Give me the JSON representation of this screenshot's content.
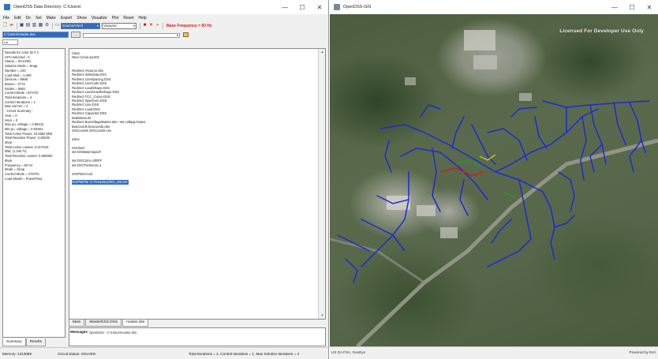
{
  "left_window": {
    "title": "OpenDSS Data Directory: C:\\Users\\",
    "controls": {
      "minimize": "—",
      "maximize": "☐",
      "close": "✕"
    },
    "menu": [
      "File",
      "Edit",
      "Do",
      "Set",
      "Make",
      "Export",
      "Show",
      "Visualize",
      "Plot",
      "Reset",
      "Help"
    ],
    "toolbar": {
      "combo_source": "Source/Vsrcl",
      "combo_class": "Vsource",
      "frequency_label": "Base Frequency = 60 Hz"
    },
    "path_field": "C:\\Users\\master.dss",
    "path_button": "...",
    "summary_lines": [
      "Results for Actor ID # 1",
      "CPU selected : 0",
      "Status = SOLVED",
      "Solution Mode = Snap",
      "Number = 100",
      "Load Mult = 1.000",
      "Devices = 6858",
      "Buses = 3774",
      "Nodes = 9661",
      "Control Mode =STATIC",
      "Total Iterations = 4",
      "Control Iterations = 1",
      "Max Sol Iter = 4",
      "",
      " - Circuit Summary -",
      "",
      "Year = 0",
      "Hour = 0",
      "Max pu. voltage = 0.96212",
      "Min pu. voltage = 0.93461",
      "Total Active Power:   23.6062 MW",
      "Total Reactive Power: 3.38238",
      "Mvar",
      "Total Active Losses:   0.317319",
      "MW, (1.344 %)",
      "Total Reactive Losses: 0.668352",
      "Mvar",
      "Frequency = 60 Hz",
      "Mode = Snap",
      "Control Mode = STATIC",
      "Load Model = PowerFlow"
    ],
    "left_tabs": [
      "Summary",
      "Results"
    ],
    "script_lines": [
      "Clear",
      "New Circuit.ipc201",
      "",
      "",
      "Redirect Vsource.dss",
      "Redirect WireData.DSS",
      "Redirect LineSpacing.DSS",
      "Redirect LineCode.DSS",
      "Redirect LoadShape.DSS",
      "Redirect LineGrowthShape.DSS",
      "Redirect TCC_Curve.DSS",
      "Redirect Spectrum.DSS",
      "Redirect Line.DSS",
      "Redirect Load.DSS",
      "Redirect Capacitor.DSS",
      "MakeBusList",
      "Redirect BusVoltageBases.dss  ! set voltage bases",
      "Buscoords buscoords.dss",
      "GISCoords GISCoords.csv",
      "",
      "solve",
      "",
      "GISStart",
      "set:GISBasemapLR",
      "",
      "set:GISColor=300FF",
      "set:GISThickness=1",
      "",
      "GISPlotCircuit",
      "",
      "GISPlotFile 'C:\\Temp\\any\\001_dat.csv'"
    ],
    "script_tabs": [
      "Main",
      "MasterDSS.DSS",
      "master.dss"
    ],
    "messages_label": "Messages",
    "messages_text": "OpenDSS - C:\\Users\\master.dss",
    "status": {
      "memory": "Memory: 121308K",
      "circuit_status": "Circuit Status: SOLVED",
      "iterations": "Total Iterations = 4, Control Iterations = 1, Max Solution Iterations = 4"
    }
  },
  "right_window": {
    "title": "OpenDSS-GIS",
    "watermark": "Licensed For Developer Use Only",
    "map_status_left": "US DA FSA, GeoEye",
    "map_status_right": "Powered by Esri",
    "feeder_color": "#1a2bd8"
  },
  "colors": {
    "selection_blue": "#2f6cbf",
    "frequency_red": "#d01818"
  }
}
